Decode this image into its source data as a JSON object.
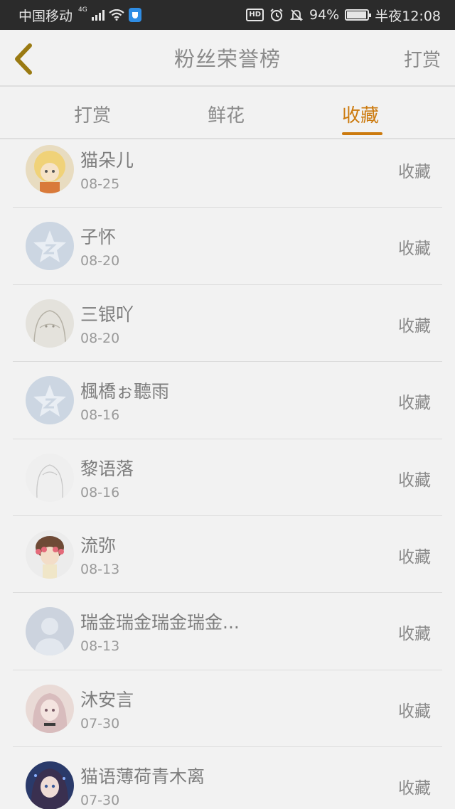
{
  "status_bar": {
    "carrier": "中国移动",
    "network_badge": "4G",
    "hd_label": "HD",
    "battery_percent": "94%",
    "battery_level": 0.94,
    "time": "半夜12:08"
  },
  "header": {
    "title": "粉丝荣誉榜",
    "action_label": "打赏"
  },
  "tabs": [
    {
      "label": "打赏",
      "active": false
    },
    {
      "label": "鲜花",
      "active": false
    },
    {
      "label": "收藏",
      "active": true
    }
  ],
  "accent_color": "#cc7a0e",
  "fans": [
    {
      "name": "猫朵儿",
      "date": "08-25",
      "action": "收藏",
      "avatar": "anime-avatar-yellow"
    },
    {
      "name": "子怀",
      "date": "08-20",
      "action": "收藏",
      "avatar": "default-star-avatar"
    },
    {
      "name": "三银吖",
      "date": "08-20",
      "action": "收藏",
      "avatar": "sketch-avatar"
    },
    {
      "name": "楓橋ぉ聽雨",
      "date": "08-16",
      "action": "收藏",
      "avatar": "default-star-avatar"
    },
    {
      "name": "黎语落",
      "date": "08-16",
      "action": "收藏",
      "avatar": "sketch-avatar-light"
    },
    {
      "name": "流弥",
      "date": "08-13",
      "action": "收藏",
      "avatar": "anime-avatar-flower"
    },
    {
      "name": "瑞金瑞金瑞金瑞金...",
      "date": "08-13",
      "action": "收藏",
      "avatar": "default-person-avatar"
    },
    {
      "name": "沐安言",
      "date": "07-30",
      "action": "收藏",
      "avatar": "anime-avatar-pink"
    },
    {
      "name": "猫语薄荷青木离",
      "date": "07-30",
      "action": "收藏",
      "avatar": "anime-avatar-blue"
    }
  ]
}
